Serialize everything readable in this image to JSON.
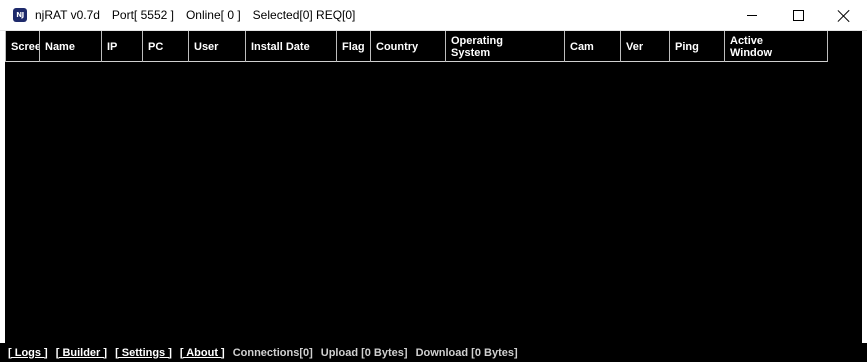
{
  "window": {
    "icon_label": "NJ",
    "app_title": "njRAT v0.7d",
    "port": "Port[ 5552 ]",
    "online": "Online[ 0 ]",
    "selected_req": "Selected[0] REQ[0]"
  },
  "columns": [
    {
      "label": "Screen"
    },
    {
      "label": "Name"
    },
    {
      "label": "IP"
    },
    {
      "label": "PC"
    },
    {
      "label": "User"
    },
    {
      "label": "Install Date"
    },
    {
      "label": "Flag"
    },
    {
      "label": "Country"
    },
    {
      "label": "Operating\nSystem"
    },
    {
      "label": "Cam"
    },
    {
      "label": "Ver"
    },
    {
      "label": "Ping"
    },
    {
      "label": "Active\nWindow"
    }
  ],
  "statusbar": {
    "logs": "[ Logs ]",
    "builder": "[ Builder ]",
    "settings": "[ Settings ]",
    "about": "[ About ]",
    "connections": "Connections[0]",
    "upload": "Upload [0 Bytes]",
    "download": "Download [0 Bytes]"
  },
  "colors": {
    "list_background": "#000000",
    "header_text": "#ffffff",
    "title_background": "#ffffff"
  }
}
